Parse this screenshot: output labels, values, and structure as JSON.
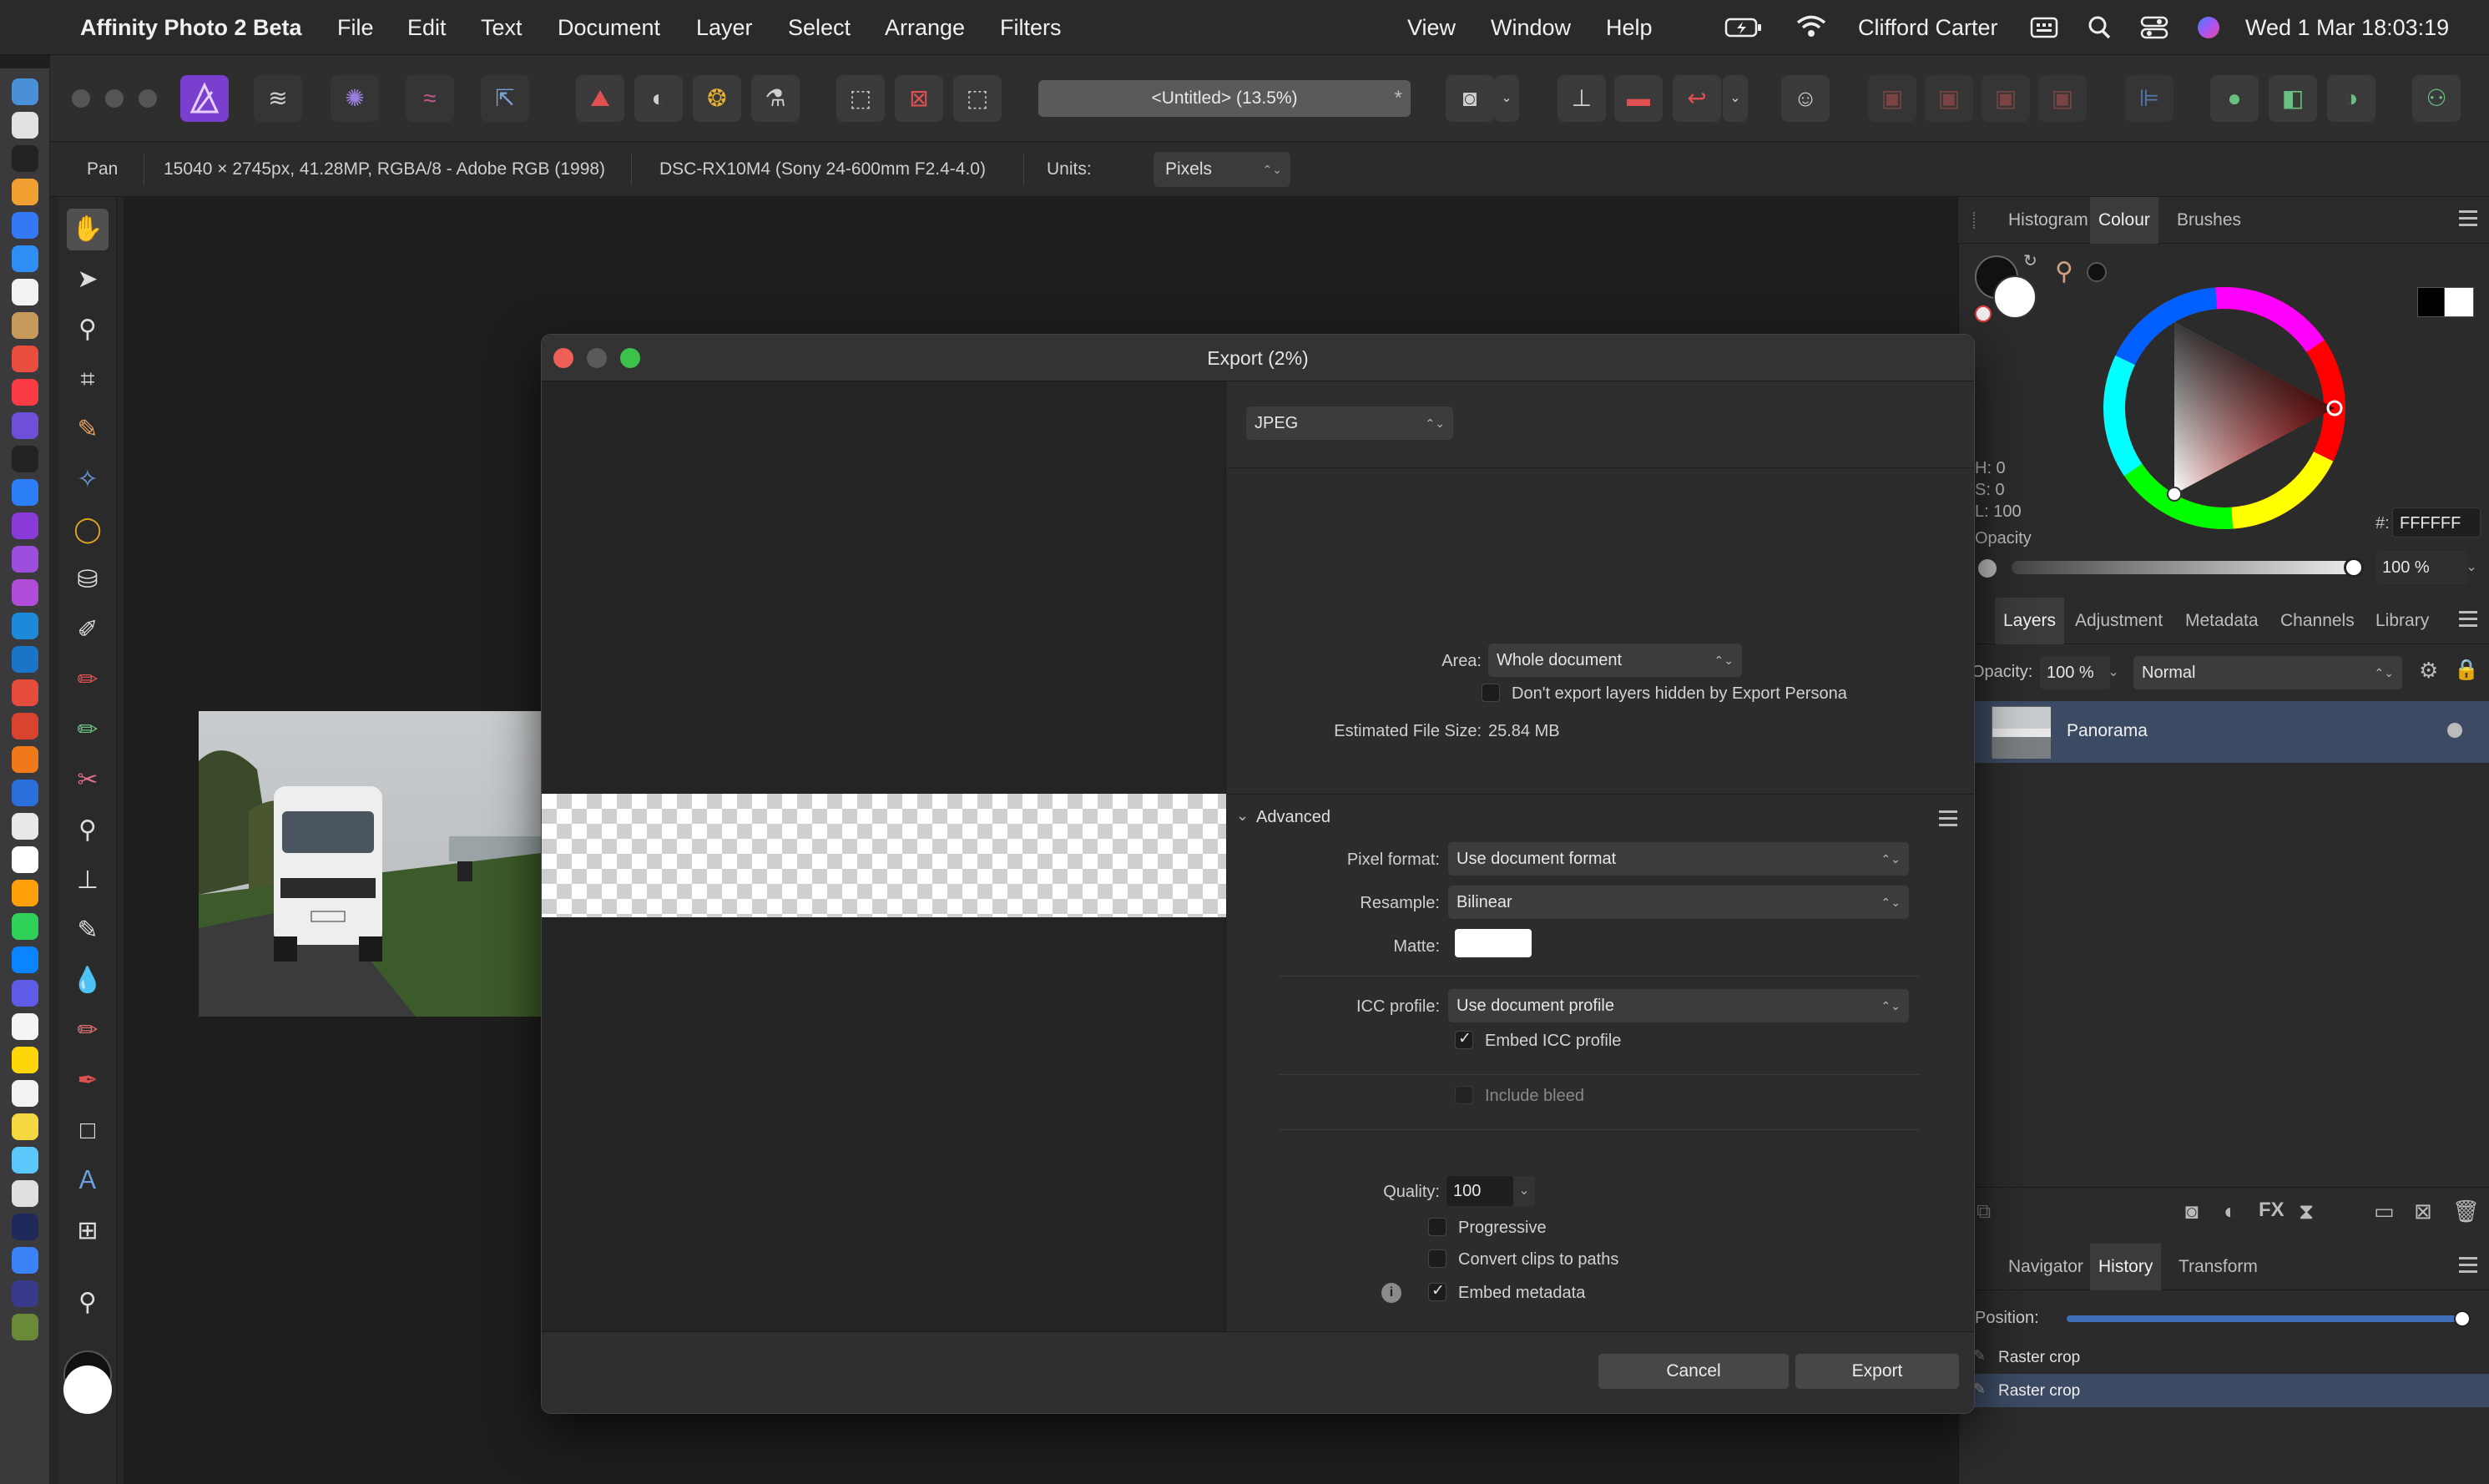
{
  "menubar": {
    "app_name": "Affinity Photo 2 Beta",
    "menus": [
      "File",
      "Edit",
      "Text",
      "Document",
      "Layer",
      "Select",
      "Arrange",
      "Filters",
      "View",
      "Window",
      "Help"
    ],
    "user": "Clifford Carter",
    "datetime": "Wed 1 Mar  18:03:19"
  },
  "toolbar": {
    "document_tab": "<Untitled> (13.5%)",
    "document_tab_star": "*"
  },
  "contextbar": {
    "tool": "Pan",
    "doc_info": "15040 × 2745px, 41.28MP, RGBA/8 - Adobe RGB (1998)",
    "camera": "DSC-RX10M4 (Sony 24-600mm F2.4-4.0)",
    "units_label": "Units:",
    "units_value": "Pixels"
  },
  "colour_panel": {
    "tabs": [
      "Histogram",
      "Colour",
      "Brushes"
    ],
    "active_tab": "Colour",
    "hsl": {
      "h": "H: 0",
      "s": "S: 0",
      "l": "L: 100"
    },
    "hex_label": "#:",
    "hex_value": "FFFFFF",
    "opacity_label": "Opacity",
    "opacity_value": "100 %"
  },
  "layers_panel": {
    "tabs": [
      "Layers",
      "Adjustment",
      "Metadata",
      "Channels",
      "Library"
    ],
    "active_tab": "Layers",
    "opacity_label": "Opacity:",
    "opacity_value": "100 %",
    "blend_mode": "Normal",
    "layer_name": "Panorama"
  },
  "history_panel": {
    "tabs": [
      "Navigator",
      "History",
      "Transform"
    ],
    "active_tab": "History",
    "position_label": "Position:",
    "entries": [
      "Raster crop",
      "Raster crop"
    ]
  },
  "export_dialog": {
    "title": "Export (2%)",
    "format": "JPEG",
    "area_label": "Area:",
    "area_value": "Whole document",
    "dont_export_hidden": "Don't export layers hidden by Export Persona",
    "file_size_label": "Estimated File Size:",
    "file_size_value": "25.84 MB",
    "advanced_label": "Advanced",
    "pixel_format_label": "Pixel format:",
    "pixel_format_value": "Use document format",
    "resample_label": "Resample:",
    "resample_value": "Bilinear",
    "matte_label": "Matte:",
    "icc_label": "ICC profile:",
    "icc_value": "Use document profile",
    "embed_icc": "Embed ICC profile",
    "include_bleed": "Include bleed",
    "quality_label": "Quality:",
    "quality_value": "100",
    "progressive": "Progressive",
    "convert_clips": "Convert clips to paths",
    "embed_metadata": "Embed metadata",
    "cancel": "Cancel",
    "export": "Export"
  }
}
